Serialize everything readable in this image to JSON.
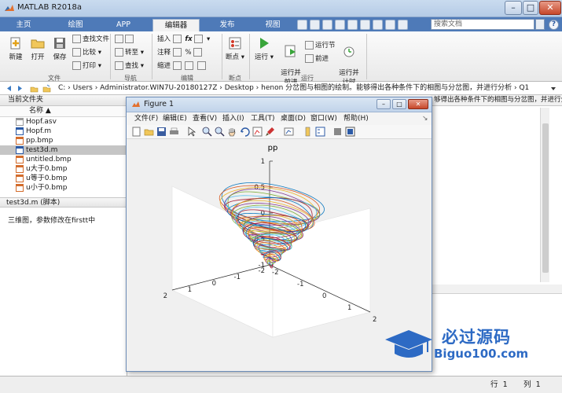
{
  "window": {
    "title": "MATLAB R2018a",
    "min": "–",
    "max": "□",
    "close": "✕"
  },
  "tabs": [
    {
      "label": "主页"
    },
    {
      "label": "绘图"
    },
    {
      "label": "APP"
    },
    {
      "label": "编辑器"
    },
    {
      "label": "发布"
    },
    {
      "label": "视图"
    }
  ],
  "search": {
    "placeholder": "搜索文档"
  },
  "help_label": "?",
  "ribbon": {
    "file": {
      "new": "新建",
      "open": "打开",
      "save": "保存",
      "find_files": "查找文件",
      "compare": "比较",
      "print": "打印",
      "group": "文件"
    },
    "navigate": {
      "goto": "转至",
      "find": "查找",
      "group": "导航"
    },
    "edit": {
      "insert": "插入",
      "fx": "fx",
      "comment": "注释",
      "percent": "%",
      "indent": "缩进",
      "group": "编辑"
    },
    "breakpoints": {
      "label": "断点",
      "group": "断点"
    },
    "run": {
      "run": "运行",
      "run_advance": "运行并\n前进",
      "run_section": "运行节",
      "advance": "前进",
      "run_time": "运行并\n计时",
      "group": "运行"
    }
  },
  "address": {
    "path": "C:  ›  Users  ›  Administrator.WIN7U-20180127Z  ›  Desktop  ›  henon 分岔图与相图的绘制。能够得出各种条件下的相图与分岔图，并进行分析  ›  Q1"
  },
  "folder_panel": {
    "title": "当前文件夹",
    "column_name": "名称 ▲",
    "files": [
      {
        "name": "Hopf.asv",
        "icon": "asv-file-icon",
        "selected": false
      },
      {
        "name": "Hopf.m",
        "icon": "m-file-icon",
        "selected": false
      },
      {
        "name": "pp.bmp",
        "icon": "bmp-file-icon",
        "selected": false
      },
      {
        "name": "test3d.m",
        "icon": "m-file-icon",
        "selected": true
      },
      {
        "name": "untitled.bmp",
        "icon": "bmp-file-icon",
        "selected": false
      },
      {
        "name": "u大于0.bmp",
        "icon": "bmp-file-icon",
        "selected": false
      },
      {
        "name": "u等于0.bmp",
        "icon": "bmp-file-icon",
        "selected": false
      },
      {
        "name": "u小于0.bmp",
        "icon": "bmp-file-icon",
        "selected": false
      }
    ]
  },
  "details": {
    "title": "test3d.m  (脚本)",
    "description": "三维图，参数修改在firstt中"
  },
  "editor": {
    "breadcrumb": "够得出各种条件下的相图与分岔图，并进行分析"
  },
  "status": {
    "row_label": "行",
    "row_value": "1",
    "col_label": "列",
    "col_value": "1"
  },
  "figure": {
    "title": "Figure 1",
    "menus": [
      "文件(F)",
      "编辑(E)",
      "查看(V)",
      "插入(I)",
      "工具(T)",
      "桌面(D)",
      "窗口(W)",
      "帮助(H)"
    ],
    "plot_title": "pp",
    "z_ticks": [
      "1",
      "0.5",
      "0",
      "-0.5",
      "-1"
    ],
    "x_ticks": [
      "2",
      "1",
      "0",
      "-1",
      "-2"
    ],
    "y_ticks": [
      "-2",
      "-1",
      "0",
      "1",
      "2"
    ]
  },
  "chart_data": {
    "type": "line",
    "title": "pp",
    "dimension": "3d",
    "xlim": [
      -2,
      2
    ],
    "ylim": [
      -2,
      2
    ],
    "zlim": [
      -1,
      1
    ],
    "grid": false,
    "series_colors": [
      "#0072BD",
      "#D95319",
      "#EDB120",
      "#7E2F8E",
      "#77AC30",
      "#4DBEEE",
      "#A2142F"
    ]
  },
  "watermark": {
    "text": "必过源码",
    "sub": "Biguo100.com"
  }
}
